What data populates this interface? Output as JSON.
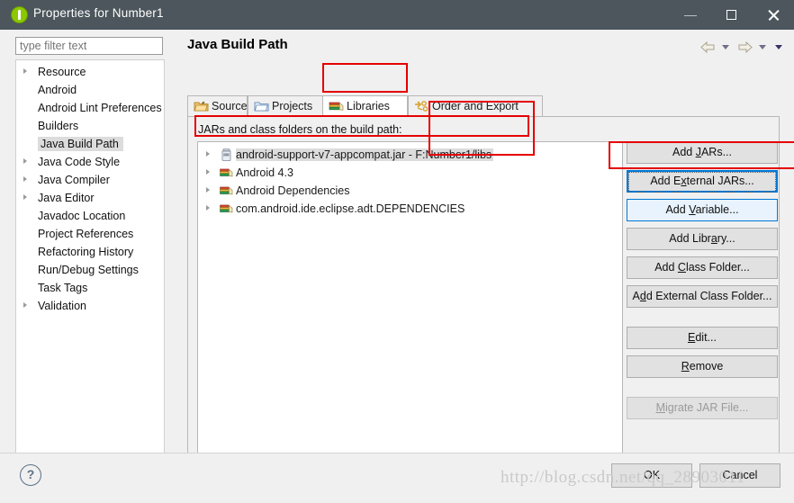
{
  "window": {
    "title": "Properties for Number1",
    "icon": "eclipse-properties-icon",
    "minimize_label": "Minimize",
    "maximize_label": "Maximize",
    "close_label": "Close"
  },
  "sidebar": {
    "filter_placeholder": "type filter text",
    "filter_value": "",
    "items": [
      {
        "label": "Resource",
        "expandable": true,
        "selected": false
      },
      {
        "label": "Android",
        "expandable": false,
        "selected": false
      },
      {
        "label": "Android Lint Preferences",
        "expandable": false,
        "selected": false
      },
      {
        "label": "Builders",
        "expandable": false,
        "selected": false
      },
      {
        "label": "Java Build Path",
        "expandable": false,
        "selected": true
      },
      {
        "label": "Java Code Style",
        "expandable": true,
        "selected": false
      },
      {
        "label": "Java Compiler",
        "expandable": true,
        "selected": false
      },
      {
        "label": "Java Editor",
        "expandable": true,
        "selected": false
      },
      {
        "label": "Javadoc Location",
        "expandable": false,
        "selected": false
      },
      {
        "label": "Project References",
        "expandable": false,
        "selected": false
      },
      {
        "label": "Refactoring History",
        "expandable": false,
        "selected": false
      },
      {
        "label": "Run/Debug Settings",
        "expandable": false,
        "selected": false
      },
      {
        "label": "Task Tags",
        "expandable": false,
        "selected": false
      },
      {
        "label": "Validation",
        "expandable": true,
        "selected": false
      }
    ],
    "hscroll_left": "❮",
    "hscroll_right": "❯"
  },
  "main": {
    "title": "Java Build Path",
    "nav": {
      "back_icon": "back-arrow-icon",
      "back_menu_icon": "chevron-down-icon",
      "forward_icon": "forward-arrow-icon",
      "forward_menu_icon": "chevron-down-icon",
      "view_menu_icon": "chevron-down-filled-icon"
    },
    "tabs": [
      {
        "label": "Source",
        "icon": "source-folder-icon",
        "active": false
      },
      {
        "label": "Projects",
        "icon": "projects-folder-icon",
        "active": false
      },
      {
        "label": "Libraries",
        "icon": "libraries-books-icon",
        "active": true
      },
      {
        "label": "Order and Export",
        "icon": "order-export-icon",
        "active": false
      }
    ],
    "list_label": "JARs and class folders on the build path:",
    "entries": [
      {
        "label": "android-support-v7-appcompat.jar - F:Number1/libs",
        "icon": "jar-icon",
        "expandable": true,
        "selected": true
      },
      {
        "label": "Android 4.3",
        "icon": "library-icon",
        "expandable": true,
        "selected": false
      },
      {
        "label": "Android Dependencies",
        "icon": "library-icon",
        "expandable": true,
        "selected": false
      },
      {
        "label": "com.android.ide.eclipse.adt.DEPENDENCIES",
        "icon": "library-icon",
        "expandable": true,
        "selected": false
      }
    ],
    "buttons": [
      {
        "label": "Add JARs...",
        "mnemonic": "J",
        "state": "normal"
      },
      {
        "label": "Add External JARs...",
        "mnemonic": "x",
        "state": "focused"
      },
      {
        "label": "Add Variable...",
        "mnemonic": "V",
        "state": "highlight"
      },
      {
        "label": "Add Library...",
        "mnemonic": "a",
        "state": "normal"
      },
      {
        "label": "Add Class Folder...",
        "mnemonic": "C",
        "state": "normal"
      },
      {
        "label": "Add External Class Folder...",
        "mnemonic": "d",
        "state": "normal"
      },
      {
        "label": "Edit...",
        "mnemonic": "E",
        "state": "normal",
        "spacer_before": true
      },
      {
        "label": "Remove",
        "mnemonic": "R",
        "state": "normal"
      },
      {
        "label": "Migrate JAR File...",
        "mnemonic": "M",
        "state": "disabled",
        "spacer_before": true
      }
    ]
  },
  "footer": {
    "help_label": "?",
    "ok_label": "OK",
    "cancel_label": "Cancel",
    "watermark": "http://blog.csdn.net/qq_28903011"
  },
  "annotations": {
    "color": "#e50000",
    "boxes": [
      {
        "name": "libraries-tab-highlight"
      },
      {
        "name": "jar-entry-row-highlight"
      },
      {
        "name": "jar-path-highlight"
      },
      {
        "name": "add-external-jars-highlight"
      }
    ]
  }
}
